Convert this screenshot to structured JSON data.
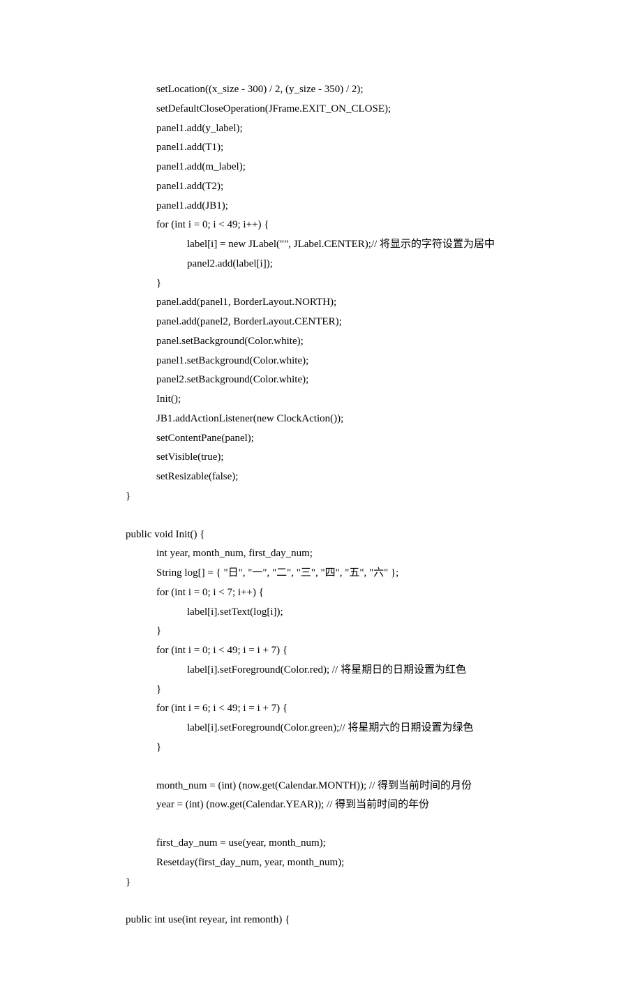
{
  "code_lines": [
    {
      "indent": 2,
      "text": "setLocation((x_size - 300) / 2, (y_size - 350) / 2);"
    },
    {
      "indent": 2,
      "text": "setDefaultCloseOperation(JFrame.EXIT_ON_CLOSE);"
    },
    {
      "indent": 2,
      "text": "panel1.add(y_label);"
    },
    {
      "indent": 2,
      "text": "panel1.add(T1);"
    },
    {
      "indent": 2,
      "text": "panel1.add(m_label);"
    },
    {
      "indent": 2,
      "text": "panel1.add(T2);"
    },
    {
      "indent": 2,
      "text": "panel1.add(JB1);"
    },
    {
      "indent": 2,
      "text": "for (int i = 0; i < 49; i++) {"
    },
    {
      "indent": 4,
      "text": "label[i] = new JLabel(\"\", JLabel.CENTER);// 将显示的字符设置为居中"
    },
    {
      "indent": 4,
      "text": "panel2.add(label[i]);"
    },
    {
      "indent": 2,
      "text": "}"
    },
    {
      "indent": 2,
      "text": "panel.add(panel1, BorderLayout.NORTH);"
    },
    {
      "indent": 2,
      "text": "panel.add(panel2, BorderLayout.CENTER);"
    },
    {
      "indent": 2,
      "text": "panel.setBackground(Color.white);"
    },
    {
      "indent": 2,
      "text": "panel1.setBackground(Color.white);"
    },
    {
      "indent": 2,
      "text": "panel2.setBackground(Color.white);"
    },
    {
      "indent": 2,
      "text": "Init();"
    },
    {
      "indent": 2,
      "text": "JB1.addActionListener(new ClockAction());"
    },
    {
      "indent": 2,
      "text": "setContentPane(panel);"
    },
    {
      "indent": 2,
      "text": "setVisible(true);"
    },
    {
      "indent": 2,
      "text": "setResizable(false);"
    },
    {
      "indent": 0,
      "text": "}"
    },
    {
      "indent": 0,
      "text": "",
      "blank": true
    },
    {
      "indent": 0,
      "text": "public void Init() {"
    },
    {
      "indent": 2,
      "text": "int year, month_num, first_day_num;"
    },
    {
      "indent": 2,
      "text": "String log[] = { \"日\", \"一\", \"二\", \"三\", \"四\", \"五\", \"六\" };"
    },
    {
      "indent": 2,
      "text": "for (int i = 0; i < 7; i++) {"
    },
    {
      "indent": 4,
      "text": "label[i].setText(log[i]);"
    },
    {
      "indent": 2,
      "text": "}"
    },
    {
      "indent": 2,
      "text": "for (int i = 0; i < 49; i = i + 7) {"
    },
    {
      "indent": 4,
      "text": "label[i].setForeground(Color.red); // 将星期日的日期设置为红色"
    },
    {
      "indent": 2,
      "text": "}"
    },
    {
      "indent": 2,
      "text": "for (int i = 6; i < 49; i = i + 7) {"
    },
    {
      "indent": 4,
      "text": "label[i].setForeground(Color.green);// 将星期六的日期设置为绿色"
    },
    {
      "indent": 2,
      "text": "}"
    },
    {
      "indent": 2,
      "text": "",
      "blank": true
    },
    {
      "indent": 2,
      "text": "month_num = (int) (now.get(Calendar.MONTH)); // 得到当前时间的月份"
    },
    {
      "indent": 2,
      "text": "year = (int) (now.get(Calendar.YEAR)); // 得到当前时间的年份"
    },
    {
      "indent": 2,
      "text": "",
      "blank": true
    },
    {
      "indent": 2,
      "text": "first_day_num = use(year, month_num);"
    },
    {
      "indent": 2,
      "text": "Resetday(first_day_num, year, month_num);"
    },
    {
      "indent": 0,
      "text": "}"
    },
    {
      "indent": 0,
      "text": "",
      "blank": true
    },
    {
      "indent": 0,
      "text": "public int use(int reyear, int remonth) {"
    }
  ]
}
